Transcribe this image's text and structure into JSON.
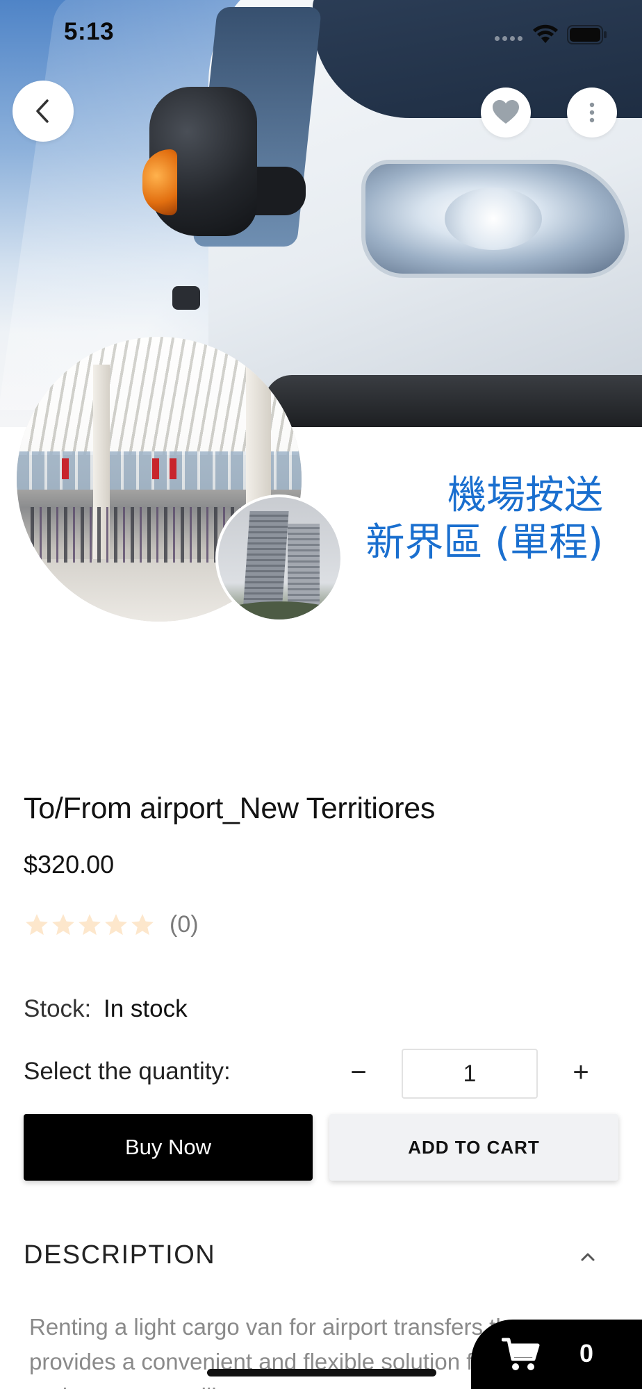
{
  "status_bar": {
    "time": "5:13"
  },
  "hero": {
    "back_icon": "chevron-left-icon",
    "favorite_icon": "heart-icon",
    "more_icon": "vertical-dots-icon"
  },
  "banner": {
    "line1": "機場按送",
    "line2": "新界區 (單程)",
    "text_color": "#1a6fcf"
  },
  "product": {
    "title": "To/From airport_New Territiores",
    "price": "$320.00",
    "rating": {
      "stars": 0,
      "max_stars": 5,
      "count_label": "(0)",
      "star_color": "#fde7cc"
    },
    "stock": {
      "label": "Stock:",
      "value": "In stock"
    },
    "quantity": {
      "label": "Select the quantity:",
      "decrement": "−",
      "value": "1",
      "increment": "+"
    },
    "buttons": {
      "buy_now": "Buy Now",
      "add_to_cart": "ADD TO CART"
    },
    "description": {
      "header": "DESCRIPTION",
      "text": "Renting a light cargo van for airport transfers that provides a convenient and flexible solution for individuals and groups travelling..."
    }
  },
  "floating_cart": {
    "icon": "cart-icon",
    "count": "0"
  }
}
